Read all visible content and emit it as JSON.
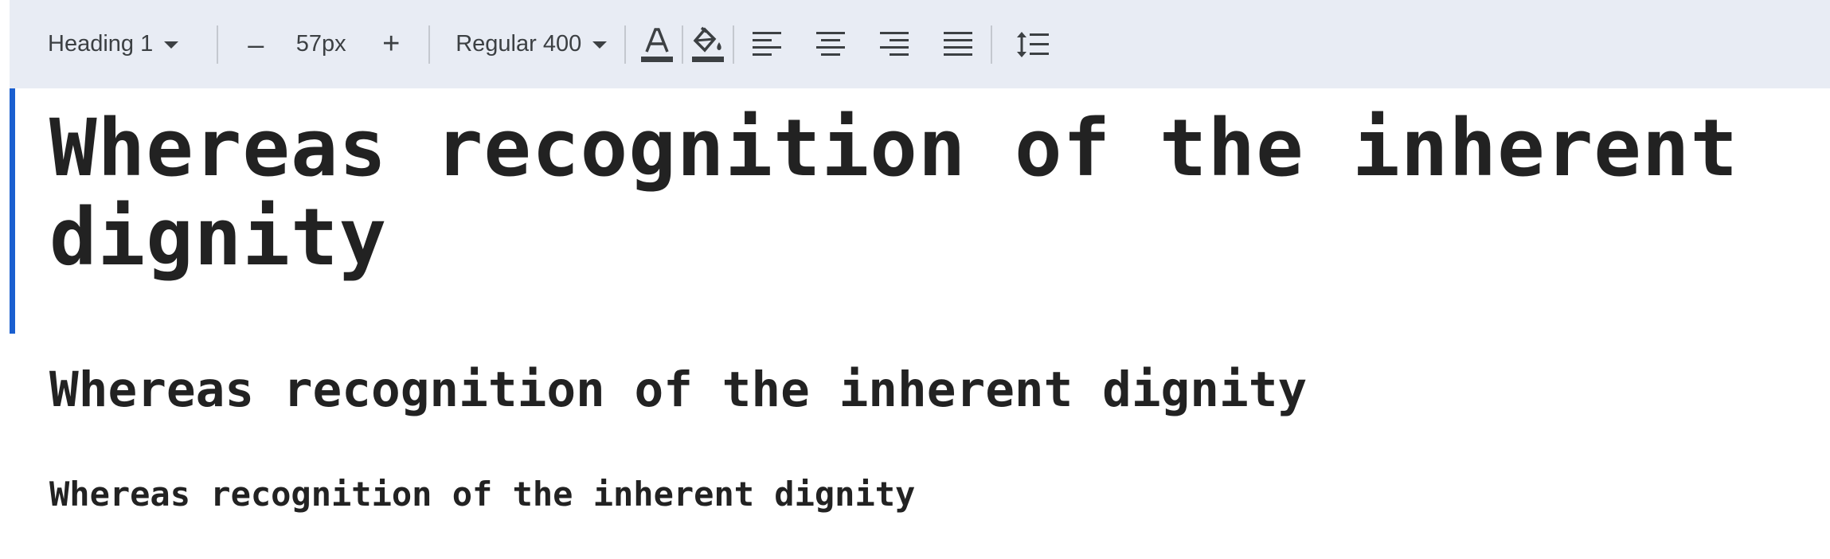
{
  "toolbar": {
    "style_dropdown": "Heading 1",
    "decrease_symbol": "–",
    "font_size": "57px",
    "increase_symbol": "+",
    "weight_dropdown": "Regular 400",
    "icons": [
      "text-color-icon",
      "fill-color-icon",
      "align-left-icon",
      "align-center-icon",
      "align-right-icon",
      "align-justify-icon",
      "line-spacing-icon"
    ]
  },
  "editor": {
    "heading1": "Whereas recognition of the inherent dignity",
    "heading2": "Whereas recognition of the inherent dignity",
    "heading3": "Whereas recognition of the inherent dignity"
  },
  "colors": {
    "toolbar_bg": "#e8ecf4",
    "active_indicator": "#1a5fd0",
    "text": "#222222",
    "icon": "#3c4043"
  }
}
